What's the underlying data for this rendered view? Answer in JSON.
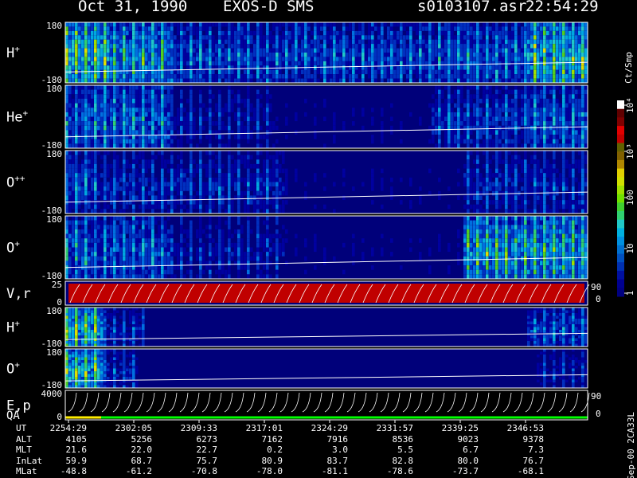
{
  "header": {
    "date": "Oct 31, 1990",
    "instrument": "EXOS-D SMS",
    "filename": "s0103107.asr",
    "time": "22:54:29"
  },
  "colorbar": {
    "unit": "Ct/Smp",
    "ticks": [
      "1",
      "10",
      "100",
      "10³",
      "10⁴"
    ],
    "colors": [
      "#000080",
      "#000090",
      "#0010a0",
      "#0030b0",
      "#0050c0",
      "#0070d0",
      "#0090e0",
      "#00b0e0",
      "#20c8c8",
      "#30d070",
      "#40d030",
      "#70e000",
      "#a0e000",
      "#d0e000",
      "#e0d000",
      "#b08800",
      "#806000",
      "#606000",
      "#c00000",
      "#e00000",
      "#800000",
      "#600000",
      "#ffffff"
    ]
  },
  "panels": [
    {
      "label": "H",
      "sup": "+",
      "top": "180",
      "bottom": "-180"
    },
    {
      "label": "He",
      "sup": "+",
      "top": "180",
      "bottom": "-180"
    },
    {
      "label": "O",
      "sup": "++",
      "top": "180",
      "bottom": "-180"
    },
    {
      "label": "O",
      "sup": "+",
      "top": "180",
      "bottom": "-180"
    },
    {
      "label": "V,r",
      "sup": "",
      "top": "25",
      "bottom": "0",
      "right_top": "90",
      "right_bottom": "0"
    },
    {
      "label": "H",
      "sup": "+",
      "top": "180",
      "bottom": "-180"
    },
    {
      "label": "O",
      "sup": "+",
      "top": "180",
      "bottom": "-180"
    },
    {
      "label": "E,p",
      "sup": "",
      "top": "4000",
      "bottom": "0",
      "right_top": "90",
      "right_bottom": "0"
    }
  ],
  "qa_label": "QA",
  "side_label": "Sep-00 2CA33L",
  "chart_data": {
    "type": "heatmap",
    "title": "Oct 31, 1990   EXOS-D SMS   s0103107.asr   22:54:29",
    "x_ticks": [
      "2254:29",
      "2302:05",
      "2309:33",
      "2317:01",
      "2324:29",
      "2331:57",
      "2339:25",
      "2346:53"
    ],
    "ephemeris": {
      "UT": [
        "2254:29",
        "2302:05",
        "2309:33",
        "2317:01",
        "2324:29",
        "2331:57",
        "2339:25",
        "2346:53"
      ],
      "ALT": [
        "4105",
        "5256",
        "6273",
        "7162",
        "7916",
        "8536",
        "9023",
        "9378"
      ],
      "MLT": [
        "21.6",
        "22.0",
        "22.7",
        "0.2",
        "3.0",
        "5.5",
        "6.7",
        "7.3"
      ],
      "InLat": [
        "59.9",
        "68.7",
        "75.7",
        "80.9",
        "83.7",
        "82.8",
        "80.0",
        "76.7"
      ],
      "MLat": [
        "-48.8",
        "-61.2",
        "-70.8",
        "-78.0",
        "-81.1",
        "-78.6",
        "-73.7",
        "-68.1"
      ]
    },
    "series": [
      {
        "name": "H+",
        "activity": [
          [
            0,
            0.08,
            0.9
          ],
          [
            0.08,
            0.2,
            0.7
          ],
          [
            0.2,
            0.7,
            0.45
          ],
          [
            0.7,
            0.88,
            0.5
          ],
          [
            0.88,
            1,
            0.85
          ]
        ]
      },
      {
        "name": "He+",
        "activity": [
          [
            0,
            0.04,
            0.5
          ],
          [
            0.04,
            0.2,
            0.55
          ],
          [
            0.2,
            0.4,
            0.3
          ],
          [
            0.4,
            0.7,
            0.15
          ],
          [
            0.7,
            0.88,
            0.4
          ],
          [
            0.88,
            1,
            0.5
          ]
        ]
      },
      {
        "name": "O++",
        "activity": [
          [
            0,
            0.06,
            0.45
          ],
          [
            0.06,
            0.42,
            0.35
          ],
          [
            0.42,
            0.76,
            0.15
          ],
          [
            0.76,
            1,
            0.35
          ]
        ]
      },
      {
        "name": "O+",
        "activity": [
          [
            0,
            0.05,
            0.55
          ],
          [
            0.05,
            0.2,
            0.5
          ],
          [
            0.2,
            0.42,
            0.3
          ],
          [
            0.42,
            0.76,
            0.15
          ],
          [
            0.76,
            1,
            0.75
          ]
        ]
      },
      {
        "name": "H+ (2)",
        "activity": [
          [
            0,
            0.07,
            0.85
          ],
          [
            0.07,
            0.15,
            0.35
          ],
          [
            0.15,
            0.88,
            0.08
          ],
          [
            0.88,
            1,
            0.45
          ]
        ]
      },
      {
        "name": "O+ (2)",
        "activity": [
          [
            0,
            0.07,
            0.85
          ],
          [
            0.07,
            0.14,
            0.35
          ],
          [
            0.14,
            0.9,
            0.05
          ],
          [
            0.9,
            1,
            0.3
          ]
        ]
      }
    ]
  }
}
